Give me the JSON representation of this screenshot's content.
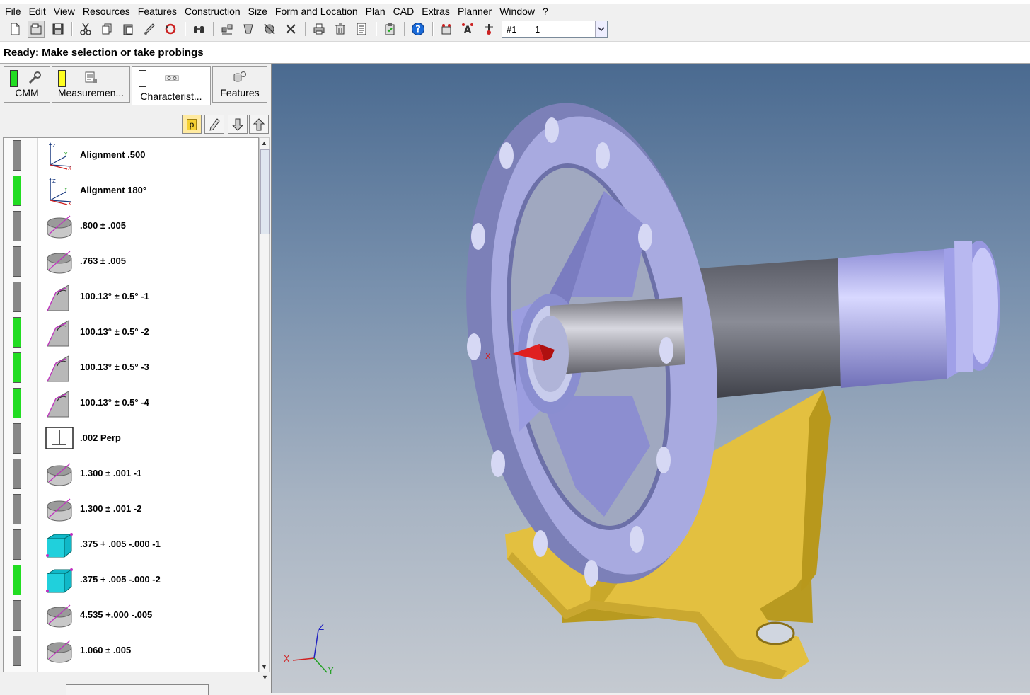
{
  "menu": [
    "File",
    "Edit",
    "View",
    "Resources",
    "Features",
    "Construction",
    "Size",
    "Form and Location",
    "Plan",
    "CAD",
    "Extras",
    "Planner",
    "Window",
    "?"
  ],
  "toolbar": {
    "icons": [
      "new-file-icon",
      "open-icon",
      "save-icon",
      "cut-icon",
      "copy-icon",
      "paste-icon",
      "probe-icon",
      "undo-icon",
      "binoculars-icon",
      "align-icon",
      "feature-icon",
      "construct-icon",
      "tools-icon",
      "print-icon",
      "delete-icon",
      "report-icon",
      "clipboard-icon",
      "help-icon",
      "program-start-icon",
      "text-icon",
      "probe-settings-icon"
    ],
    "program_select": {
      "value": "#1",
      "value2": "1"
    }
  },
  "status": {
    "text": "Ready: Make selection or take probings"
  },
  "tabs": [
    {
      "label": "CMM",
      "indicator": "#22dd22"
    },
    {
      "label": "Measuremen...",
      "indicator": "#ffff22"
    },
    {
      "label": "Characterist...",
      "indicator": "#ffffff",
      "active": true
    },
    {
      "label": "Features"
    }
  ],
  "list_buttons": {
    "p_label": "p"
  },
  "characteristics": [
    {
      "text": "Alignment .500",
      "status": "#888888",
      "icon": "alignment-axes-icon"
    },
    {
      "text": "Alignment 180°",
      "status": "#22dd22",
      "icon": "alignment-axes-icon"
    },
    {
      "text": ".800 ± .005",
      "status": "#888888",
      "icon": "cylinder-diameter-icon"
    },
    {
      "text": ".763 ± .005",
      "status": "#888888",
      "icon": "cylinder-diameter-icon"
    },
    {
      "text": "100.13° ± 0.5° -1",
      "status": "#888888",
      "icon": "angle-icon"
    },
    {
      "text": "100.13° ± 0.5° -2",
      "status": "#22dd22",
      "icon": "angle-icon"
    },
    {
      "text": "100.13° ± 0.5° -3",
      "status": "#22dd22",
      "icon": "angle-icon"
    },
    {
      "text": "100.13° ± 0.5° -4",
      "status": "#22dd22",
      "icon": "angle-icon"
    },
    {
      "text": ".002 Perp",
      "status": "#888888",
      "icon": "perpendicularity-icon"
    },
    {
      "text": "1.300 ± .001 -1",
      "status": "#888888",
      "icon": "cylinder-diameter-icon"
    },
    {
      "text": "1.300 ± .001 -2",
      "status": "#888888",
      "icon": "cylinder-diameter-icon"
    },
    {
      "text": ".375 + .005 -.000 -1",
      "status": "#888888",
      "icon": "cube-distance-icon"
    },
    {
      "text": ".375 + .005 -.000 -2",
      "status": "#22dd22",
      "icon": "cube-distance-icon"
    },
    {
      "text": "4.535 +.000 -.005",
      "status": "#888888",
      "icon": "cylinder-diameter-icon"
    },
    {
      "text": "1.060 ± .005",
      "status": "#888888",
      "icon": "cylinder-diameter-icon"
    }
  ],
  "viewport": {
    "axis_labels": {
      "x": "X",
      "y": "Y",
      "z": "Z"
    }
  }
}
